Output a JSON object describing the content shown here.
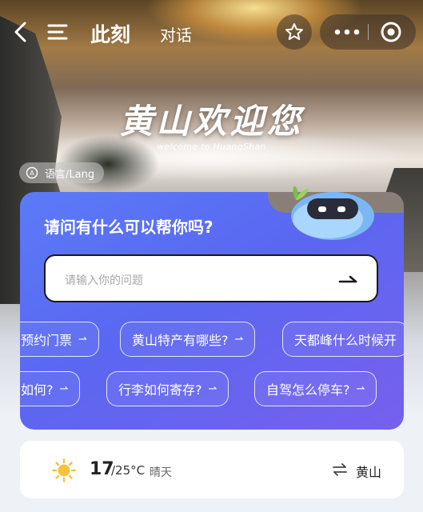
{
  "header": {
    "tab_now": "此刻",
    "tab_chat": "对话",
    "icons": {
      "back": "chevron-left-icon",
      "menu": "menu-icon",
      "favorite": "star-icon",
      "more": "more-dots-icon",
      "close": "target-close-icon"
    }
  },
  "banner": {
    "title": "黄山欢迎您",
    "subtitle": "welcome to HuangShan"
  },
  "language": {
    "label": "语言/Lang",
    "icon": "language-icon"
  },
  "assistant": {
    "question": "请问有什么可以帮你吗?",
    "input_placeholder": "请输入你的问题",
    "send_icon": "arrow-right-icon",
    "mascot_icon": "robot-mascot-icon",
    "chips_row1": [
      {
        "label": "预约门票"
      },
      {
        "label": "黄山特产有哪些?"
      },
      {
        "label": "天都峰什么时候开"
      }
    ],
    "chips_row2": [
      {
        "label": "如何?"
      },
      {
        "label": "行李如何寄存?"
      },
      {
        "label": "自驾怎么停车?"
      }
    ]
  },
  "weather": {
    "icon": "sun-icon",
    "temp_now": "17",
    "temp_range": "/25°C",
    "condition": "晴天",
    "switch_icon": "switch-arrows-icon",
    "place": "黄山"
  },
  "colors": {
    "card_gradient_start": "#5b7bf7",
    "card_gradient_end": "#7760ee",
    "sun": "#f4c23c"
  }
}
